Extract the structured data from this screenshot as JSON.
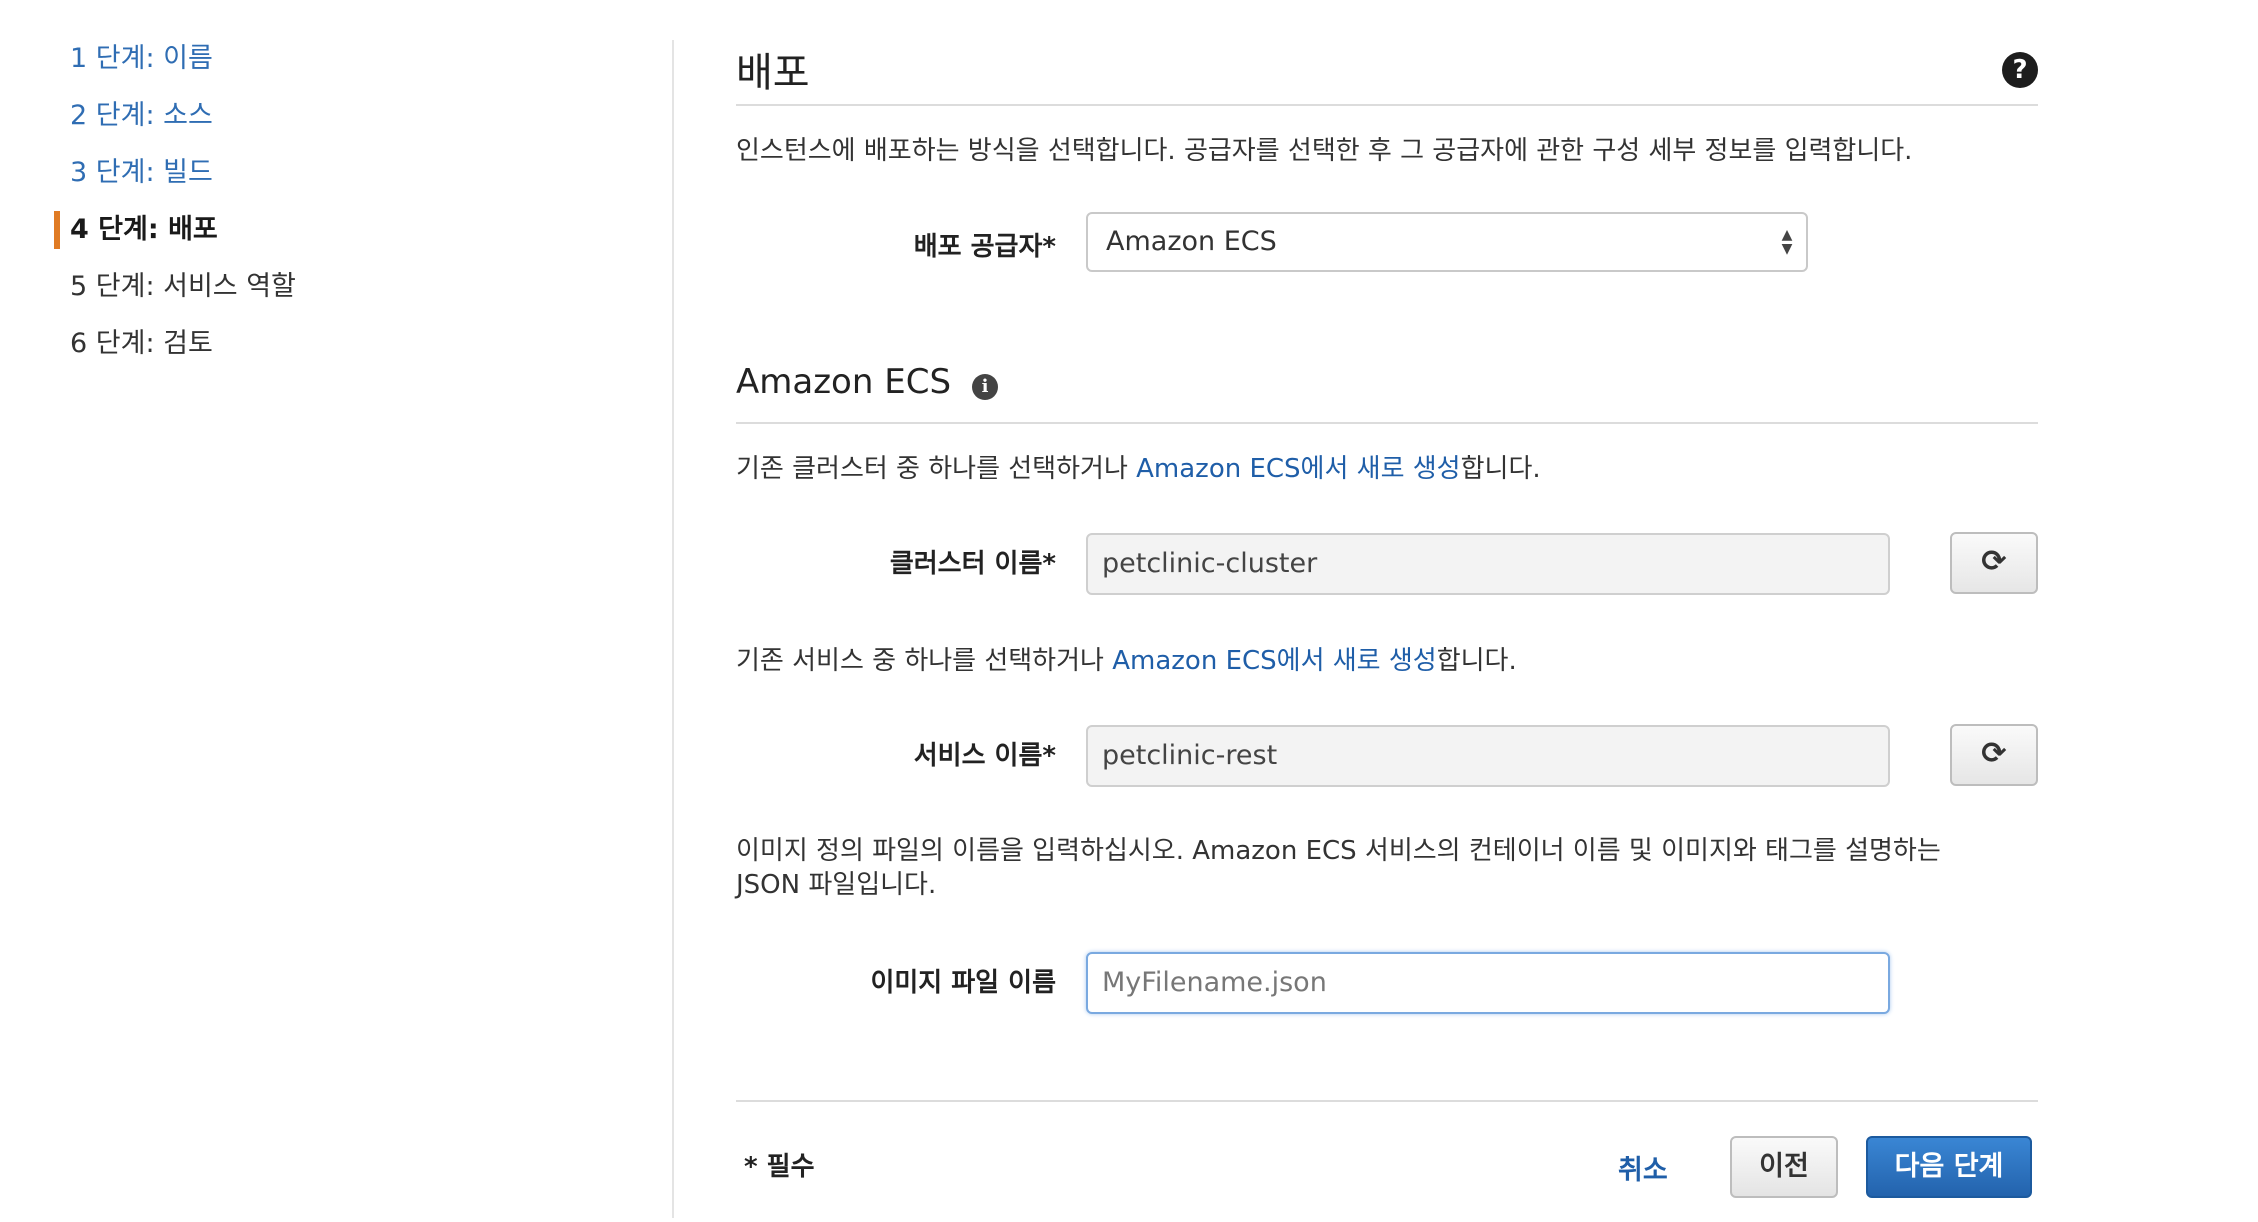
{
  "sidebar": {
    "steps": [
      {
        "label": "1 단계: 이름"
      },
      {
        "label": "2 단계: 소스"
      },
      {
        "label": "3 단계: 빌드"
      },
      {
        "label": "4 단계: 배포"
      },
      {
        "label": "5 단계: 서비스 역할"
      },
      {
        "label": "6 단계: 검토"
      }
    ]
  },
  "page": {
    "title": "배포",
    "help_icon": "question-circle-icon",
    "description": "인스턴스에 배포하는 방식을 선택합니다. 공급자를 선택한 후 그 공급자에 관한 구성 세부 정보를 입력합니다."
  },
  "provider": {
    "label": "배포 공급자*",
    "value": "Amazon ECS"
  },
  "ecs": {
    "title": "Amazon ECS",
    "info_icon": "info-icon",
    "cluster_desc_pre": "기존 클러스터 중 하나를 선택하거나 ",
    "cluster_desc_link": "Amazon ECS에서 새로 생성",
    "cluster_desc_post": "합니다.",
    "cluster_label": "클러스터 이름*",
    "cluster_value": "petclinic-cluster",
    "service_desc_pre": "기존 서비스 중 하나를 선택하거나 ",
    "service_desc_link": "Amazon ECS에서 새로 생성",
    "service_desc_post": "합니다.",
    "service_label": "서비스 이름*",
    "service_value": "petclinic-rest",
    "image_desc_line1": "이미지 정의 파일의 이름을 입력하십시오. Amazon ECS 서비스의 컨테이너 이름 및 이미지와 태그를 설명하는",
    "image_desc_line2": "JSON 파일입니다.",
    "image_label": "이미지 파일 이름",
    "image_placeholder": "MyFilename.json",
    "refresh_icon": "refresh-icon"
  },
  "footer": {
    "required_note": "* 필수",
    "cancel": "취소",
    "previous": "이전",
    "next": "다음 단계"
  }
}
